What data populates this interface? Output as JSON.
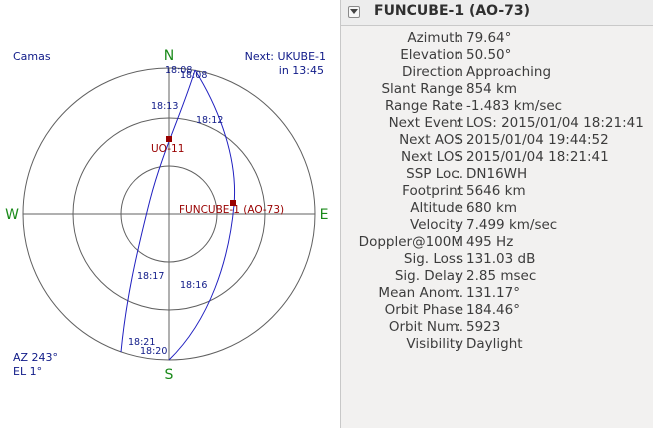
{
  "polar_view": {
    "qth_name": "Camas",
    "next_label": "Next: UKUBE-1",
    "next_time": "in 13:45",
    "compass": {
      "north": "N",
      "south": "S",
      "east": "E",
      "west": "W"
    },
    "cursor_az": "AZ 243°",
    "cursor_el": "EL 1°",
    "satellites": [
      {
        "name": "UO-11",
        "color": "#990000"
      },
      {
        "name": "FUNCUBE-1 (AO-73)",
        "color": "#990000"
      }
    ],
    "time_ticks": [
      "18:08",
      "18:08",
      "18:13",
      "18:12",
      "18:17",
      "18:16",
      "18:21",
      "18:20"
    ],
    "colors": {
      "track": "#2020c0",
      "ring": "#606060",
      "compass": "#1a8a1a",
      "label": "#0f1a88"
    }
  },
  "details": {
    "title": "FUNCUBE-1 (AO-73)",
    "rows": [
      {
        "label": "Azimuth",
        "value": "79.64°"
      },
      {
        "label": "Elevation",
        "value": "50.50°"
      },
      {
        "label": "Direction",
        "value": "Approaching"
      },
      {
        "label": "Slant Range",
        "value": "854 km"
      },
      {
        "label": "Range Rate",
        "value": "-1.483 km/sec"
      },
      {
        "label": "Next Event",
        "value": "LOS: 2015/01/04 18:21:41"
      },
      {
        "label": "Next AOS",
        "value": "2015/01/04 19:44:52"
      },
      {
        "label": "Next LOS",
        "value": "2015/01/04 18:21:41"
      },
      {
        "label": "SSP Loc.",
        "value": "DN16WH"
      },
      {
        "label": "Footprint",
        "value": "5646 km"
      },
      {
        "label": "Altitude",
        "value": "680 km"
      },
      {
        "label": "Velocity",
        "value": "7.499 km/sec"
      },
      {
        "label": "Doppler@100M",
        "value": "495 Hz"
      },
      {
        "label": "Sig. Loss",
        "value": "131.03 dB"
      },
      {
        "label": "Sig. Delay",
        "value": "2.85 msec"
      },
      {
        "label": "Mean Anom.",
        "value": "131.17°"
      },
      {
        "label": "Orbit Phase",
        "value": "184.46°"
      },
      {
        "label": "Orbit Num.",
        "value": "5923"
      },
      {
        "label": "Visibility",
        "value": "Daylight"
      }
    ]
  }
}
